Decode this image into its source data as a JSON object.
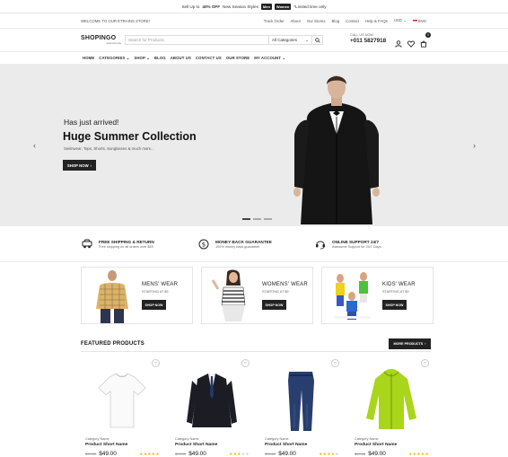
{
  "promo": {
    "prefix": "Sell Up to",
    "highlight": "40% OFF",
    "middle": "New Season Styles",
    "pill1": "Men",
    "pill2": "Women",
    "suffix": "*Limited time only"
  },
  "topbar": {
    "welcome": "WELCOME TO OUR ETRAINS STORE!",
    "links": [
      "Track Order",
      "About",
      "Our Stores",
      "Blog",
      "Contact",
      "Help & FAQs",
      "USD",
      "ENG"
    ]
  },
  "header": {
    "logo_name": "SHOPINGO",
    "logo_sub": "eCommerce",
    "search_placeholder": "Search for Products",
    "category_value": "All Categories",
    "call_label": "CALL US NOW",
    "call_number": "+011 5827918",
    "cart_count": "0"
  },
  "nav": [
    "HOME",
    "CATEGORIES ⌄",
    "SHOP ⌄",
    "BLOG",
    "ABOUT US",
    "CONTACT US",
    "OUR STORE",
    "MY ACCOUNT ⌄"
  ],
  "hero": {
    "kicker": "Has just arrived!",
    "title": "Huge Summer Collection",
    "subtitle": "Swimwear, Tops, Shorts, Sunglasses & much more...",
    "button": "SHOP NOW",
    "slides": 3,
    "active_slide": 1
  },
  "services": [
    {
      "icon": "truck-icon",
      "title": "FREE SHIPPING & RETURN",
      "desc": "Free shipping on all orders over $49"
    },
    {
      "icon": "dollar-icon",
      "title": "MONEY BACK GUARANTEE",
      "desc": "100% money back guarantee"
    },
    {
      "icon": "headset-icon",
      "title": "ONLINE SUPPORT 24/7",
      "desc": "Awesome Support for 24/7 Days"
    }
  ],
  "categories": [
    {
      "title": "MENS' WEAR",
      "sub": "STARTING AT $9",
      "button": "SHOP NOW"
    },
    {
      "title": "WOMENS' WEAR",
      "sub": "STARTING AT $9",
      "button": "SHOP NOW"
    },
    {
      "title": "KIDS' WEAR",
      "sub": "STARTING AT $9",
      "button": "SHOP NOW"
    }
  ],
  "featured": {
    "title": "FEATURED PRODUCTS",
    "more": "MORE PRODUCTS"
  },
  "products": [
    {
      "category": "Category Name",
      "name": "Product Short Name",
      "old": "$99.00",
      "price": "$49.00",
      "rating": 5,
      "image": "white-tshirt"
    },
    {
      "category": "Category Name",
      "name": "Product Short Name",
      "old": "$99.00",
      "price": "$49.00",
      "rating": 3,
      "image": "black-suit"
    },
    {
      "category": "Category Name",
      "name": "Product Short Name",
      "old": "$99.00",
      "price": "$49.00",
      "rating": 4,
      "image": "blue-jeans"
    },
    {
      "category": "Category Name",
      "name": "Product Short Name",
      "old": "$99.00",
      "price": "$49.00",
      "rating": 5,
      "image": "green-jacket"
    }
  ]
}
